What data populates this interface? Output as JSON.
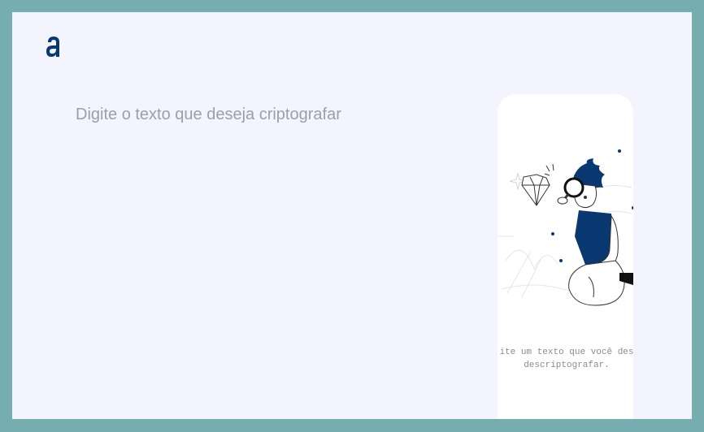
{
  "logo": {
    "icon": "brand-logo-a-icon",
    "color": "#0a3871"
  },
  "editor": {
    "placeholder": "Digite o texto que deseja criptografar",
    "value": ""
  },
  "output_panel": {
    "illustration": "person-with-magnifying-glass-icon",
    "line1": "ite um texto que você des",
    "line2": "descriptografar."
  },
  "colors": {
    "outer_border": "#76aeb0",
    "background": "#f3f4fe",
    "accent": "#0a3871"
  }
}
